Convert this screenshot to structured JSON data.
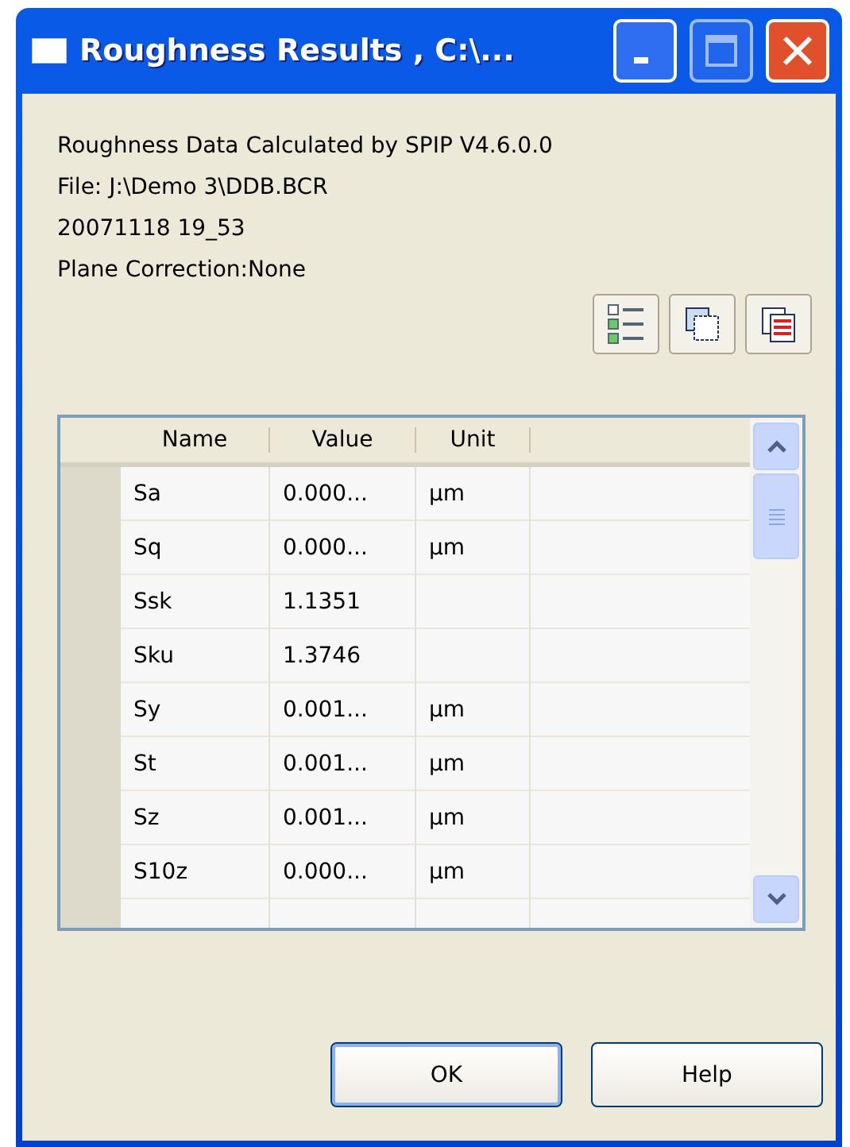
{
  "window": {
    "title": "Roughness Results , C:\\..."
  },
  "info_lines": [
    "Roughness Data Calculated by SPIP V4.6.0.0",
    "File: J:\\Demo 3\\DDB.BCR",
    "20071118 19_53",
    "Plane Correction:None"
  ],
  "table": {
    "columns": [
      "Name",
      "Value",
      "Unit"
    ],
    "rows": [
      {
        "name": "Sa",
        "value": "0.000...",
        "unit": "µm"
      },
      {
        "name": "Sq",
        "value": "0.000...",
        "unit": "µm"
      },
      {
        "name": "Ssk",
        "value": "1.1351",
        "unit": ""
      },
      {
        "name": "Sku",
        "value": "1.3746",
        "unit": ""
      },
      {
        "name": "Sy",
        "value": "0.001...",
        "unit": "µm"
      },
      {
        "name": "St",
        "value": "0.001...",
        "unit": "µm"
      },
      {
        "name": "Sz",
        "value": "0.001...",
        "unit": "µm"
      },
      {
        "name": "S10z",
        "value": "0.000...",
        "unit": "µm"
      }
    ]
  },
  "buttons": [
    "OK",
    "Help"
  ]
}
